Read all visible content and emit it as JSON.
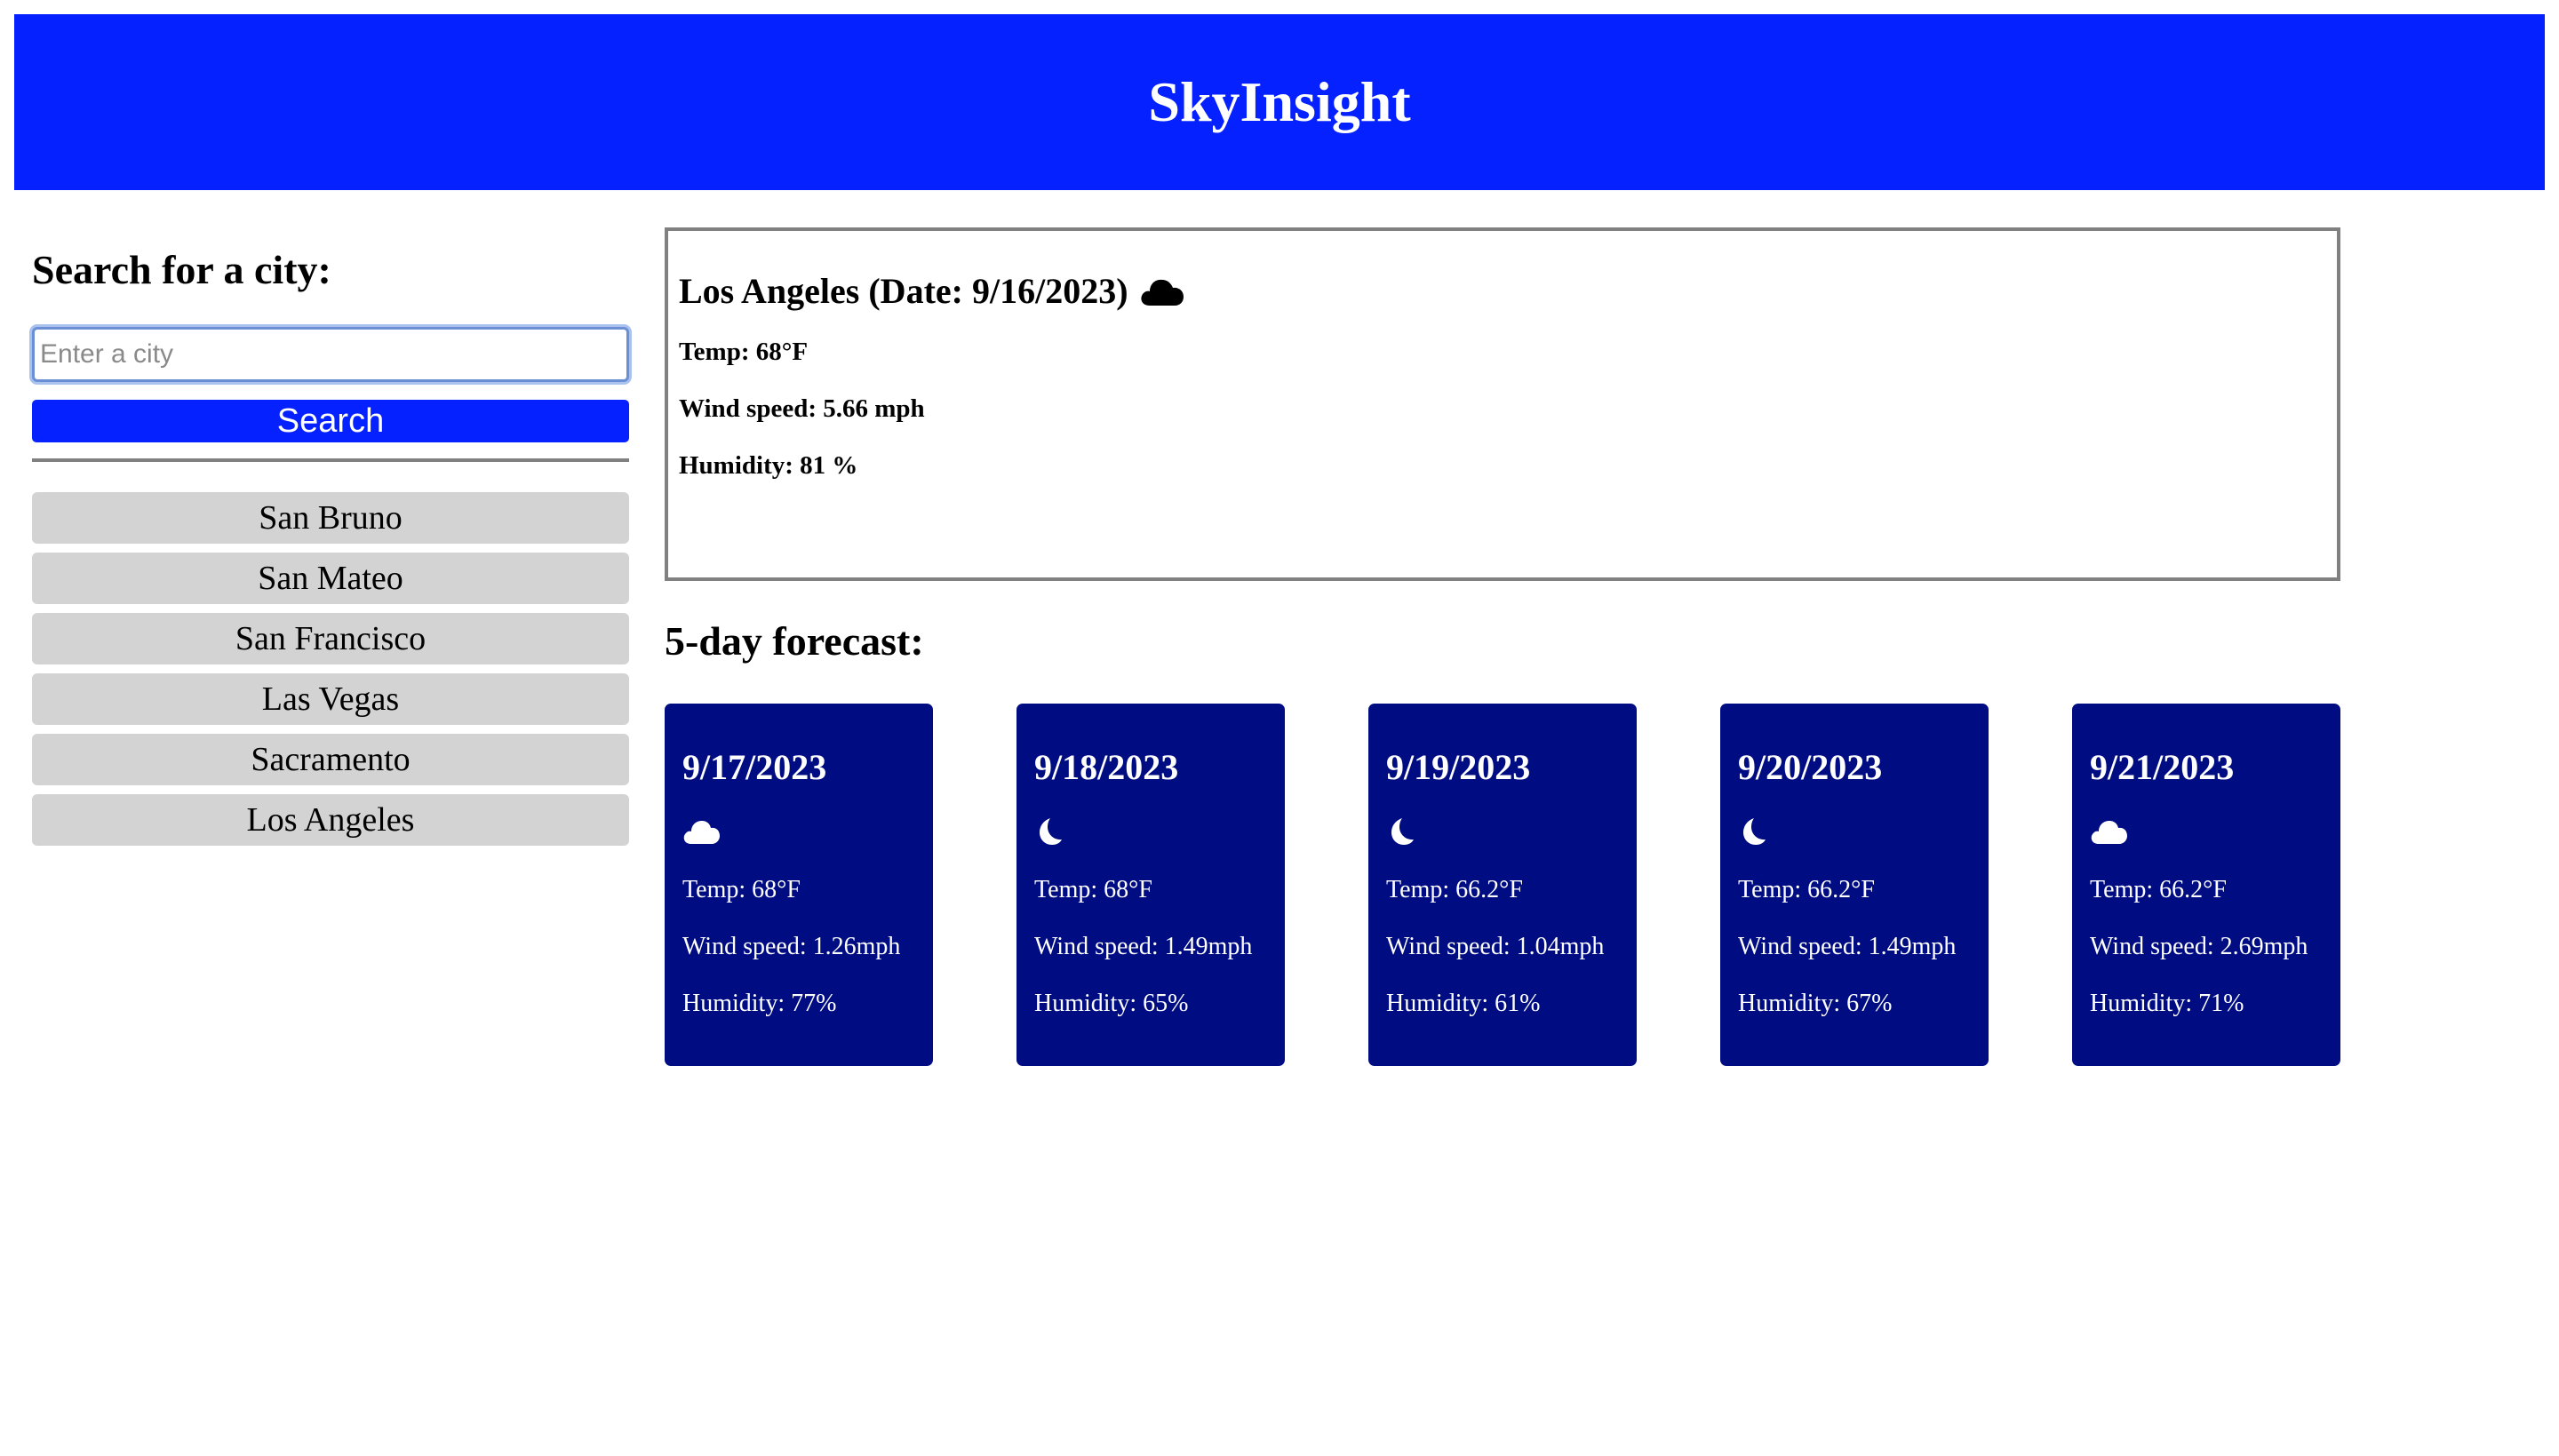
{
  "app": {
    "title": "SkyInsight"
  },
  "sidebar": {
    "heading": "Search for a city:",
    "search": {
      "placeholder": "Enter a city",
      "value": ""
    },
    "search_button_label": "Search",
    "history": [
      "San Bruno",
      "San Mateo",
      "San Francisco",
      "Las Vegas",
      "Sacramento",
      "Los Angeles"
    ]
  },
  "current": {
    "title": "Los Angeles (Date: 9/16/2023)",
    "icon": "cloud-icon",
    "temp": "Temp: 68°F",
    "wind": "Wind speed: 5.66 mph",
    "humidity": "Humidity: 81 %"
  },
  "forecast": {
    "heading": "5-day forecast:",
    "days": [
      {
        "date": "9/17/2023",
        "icon": "cloud-icon",
        "temp": "Temp: 68°F",
        "wind": "Wind speed: 1.26mph",
        "humidity": "Humidity: 77%"
      },
      {
        "date": "9/18/2023",
        "icon": "moon-icon",
        "temp": "Temp: 68°F",
        "wind": "Wind speed: 1.49mph",
        "humidity": "Humidity: 65%"
      },
      {
        "date": "9/19/2023",
        "icon": "moon-icon",
        "temp": "Temp: 66.2°F",
        "wind": "Wind speed: 1.04mph",
        "humidity": "Humidity: 61%"
      },
      {
        "date": "9/20/2023",
        "icon": "moon-icon",
        "temp": "Temp: 66.2°F",
        "wind": "Wind speed: 1.49mph",
        "humidity": "Humidity: 67%"
      },
      {
        "date": "9/21/2023",
        "icon": "cloud-icon",
        "temp": "Temp: 66.2°F",
        "wind": "Wind speed: 2.69mph",
        "humidity": "Humidity: 71%"
      }
    ]
  },
  "colors": {
    "header_bg": "#0521ff",
    "card_bg": "#000c82",
    "history_bg": "#d3d3d3",
    "border": "#808080"
  }
}
